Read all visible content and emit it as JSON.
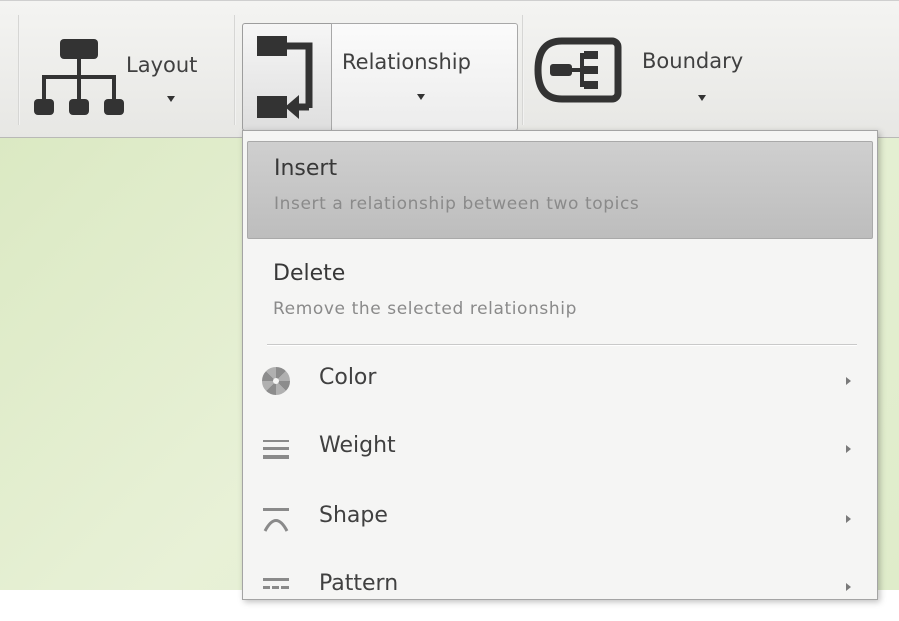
{
  "toolbar": {
    "layout": {
      "label": "Layout",
      "icon": "org-chart-icon"
    },
    "relationship": {
      "label": "Relationship",
      "icon": "relationship-icon",
      "state": "pressed"
    },
    "boundary": {
      "label": "Boundary",
      "icon": "boundary-icon"
    }
  },
  "relationship_menu": {
    "insert": {
      "title": "Insert",
      "description": "Insert a relationship between two topics"
    },
    "delete": {
      "title": "Delete",
      "description": "Remove the selected relationship"
    },
    "items": [
      {
        "label": "Color",
        "icon": "color-wheel-icon"
      },
      {
        "label": "Weight",
        "icon": "line-weight-icon"
      },
      {
        "label": "Shape",
        "icon": "curve-shape-icon"
      },
      {
        "label": "Pattern",
        "icon": "line-pattern-icon"
      }
    ]
  },
  "colors": {
    "canvas": "#e2edcf",
    "menu_highlight": "#c6c6c6",
    "toolbar_bg": "#eeeeeb"
  }
}
